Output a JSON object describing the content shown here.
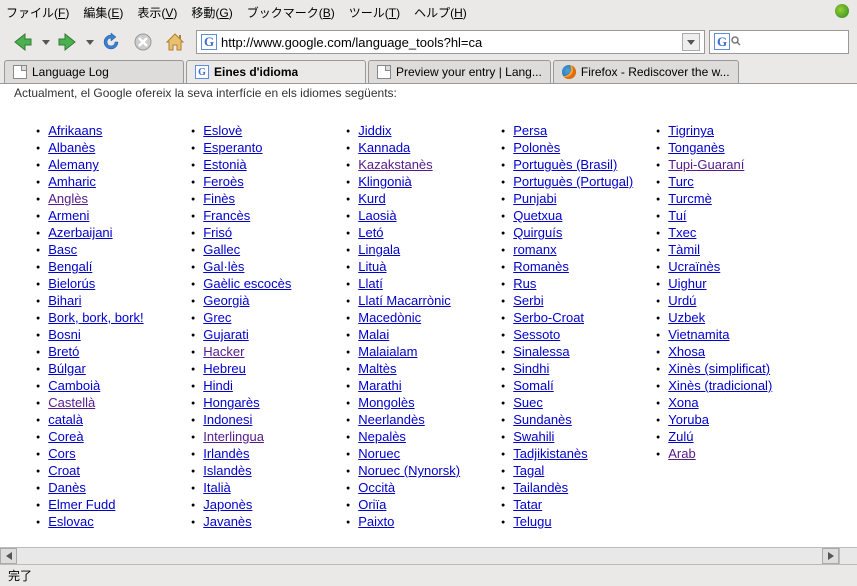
{
  "menubar": {
    "items": [
      "ファイル(F)",
      "編集(E)",
      "表示(V)",
      "移動(G)",
      "ブックマーク(B)",
      "ツール(T)",
      "ヘルプ(H)"
    ]
  },
  "toolbar": {
    "url": "http://www.google.com/language_tools?hl=ca",
    "search_placeholder": ""
  },
  "tabs": [
    {
      "label": "Language Log",
      "icon": "page",
      "active": false
    },
    {
      "label": "Eines d'idioma",
      "icon": "google",
      "active": true
    },
    {
      "label": "Preview your entry | Lang...",
      "icon": "page",
      "active": false
    },
    {
      "label": "Firefox - Rediscover the w...",
      "icon": "firefox",
      "active": false
    }
  ],
  "content": {
    "intro": "Actualment, el Google ofereix la seva interfície en els idiomes següents:",
    "columns": [
      [
        {
          "t": "Afrikaans"
        },
        {
          "t": "Albanès"
        },
        {
          "t": "Alemany"
        },
        {
          "t": "Amharic"
        },
        {
          "t": "Anglès",
          "v": true
        },
        {
          "t": "Armeni"
        },
        {
          "t": "Azerbaijani"
        },
        {
          "t": "Basc"
        },
        {
          "t": "Bengalí"
        },
        {
          "t": "Bielorús"
        },
        {
          "t": "Bihari"
        },
        {
          "t": "Bork, bork, bork!"
        },
        {
          "t": "Bosni"
        },
        {
          "t": "Bretó"
        },
        {
          "t": "Búlgar"
        },
        {
          "t": "Camboià"
        },
        {
          "t": "Castellà",
          "v": true
        },
        {
          "t": "català"
        },
        {
          "t": "Coreà"
        },
        {
          "t": "Cors"
        },
        {
          "t": "Croat"
        },
        {
          "t": "Danès"
        },
        {
          "t": "Elmer Fudd"
        },
        {
          "t": "Eslovac"
        }
      ],
      [
        {
          "t": "Eslovè"
        },
        {
          "t": "Esperanto"
        },
        {
          "t": "Estonià"
        },
        {
          "t": "Feroès"
        },
        {
          "t": "Finès"
        },
        {
          "t": "Francès"
        },
        {
          "t": "Frisó"
        },
        {
          "t": "Gallec"
        },
        {
          "t": "Gal·lès"
        },
        {
          "t": "Gaèlic escocès"
        },
        {
          "t": "Georgià"
        },
        {
          "t": "Grec"
        },
        {
          "t": "Gujarati"
        },
        {
          "t": "Hacker",
          "v": true
        },
        {
          "t": "Hebreu"
        },
        {
          "t": "Hindi"
        },
        {
          "t": "Hongarès"
        },
        {
          "t": "Indonesi"
        },
        {
          "t": "Interlingua",
          "v": true
        },
        {
          "t": "Irlandès"
        },
        {
          "t": "Islandès"
        },
        {
          "t": "Italià"
        },
        {
          "t": "Japonès"
        },
        {
          "t": "Javanès"
        }
      ],
      [
        {
          "t": "Jiddix"
        },
        {
          "t": "Kannada"
        },
        {
          "t": "Kazakstanès",
          "v": true
        },
        {
          "t": "Klingonià"
        },
        {
          "t": "Kurd"
        },
        {
          "t": "Laosià"
        },
        {
          "t": "Letó"
        },
        {
          "t": "Lingala"
        },
        {
          "t": "Lituà"
        },
        {
          "t": "Llatí"
        },
        {
          "t": "Llatí Macarrònic"
        },
        {
          "t": "Macedònic"
        },
        {
          "t": "Malai"
        },
        {
          "t": "Malaialam"
        },
        {
          "t": "Maltès"
        },
        {
          "t": "Marathi"
        },
        {
          "t": "Mongolès"
        },
        {
          "t": "Neerlandès"
        },
        {
          "t": "Nepalès"
        },
        {
          "t": "Noruec"
        },
        {
          "t": "Noruec (Nynorsk)"
        },
        {
          "t": "Occità"
        },
        {
          "t": "Oriïa"
        },
        {
          "t": "Paixto"
        }
      ],
      [
        {
          "t": "Persa"
        },
        {
          "t": "Polonès"
        },
        {
          "t": "Portuguès (Brasil)"
        },
        {
          "t": "Portuguès (Portugal)"
        },
        {
          "t": "Punjabi"
        },
        {
          "t": "Quetxua"
        },
        {
          "t": "Quirguís"
        },
        {
          "t": "romanx"
        },
        {
          "t": "Romanès"
        },
        {
          "t": "Rus"
        },
        {
          "t": "Serbi"
        },
        {
          "t": "Serbo-Croat"
        },
        {
          "t": "Sessoto"
        },
        {
          "t": "Sinalessa"
        },
        {
          "t": "Sindhi"
        },
        {
          "t": "Somalí"
        },
        {
          "t": "Suec"
        },
        {
          "t": "Sundanès"
        },
        {
          "t": "Swahili"
        },
        {
          "t": "Tadjikistanès"
        },
        {
          "t": "Tagal"
        },
        {
          "t": "Tailandès"
        },
        {
          "t": "Tatar"
        },
        {
          "t": "Telugu"
        }
      ],
      [
        {
          "t": "Tigrinya"
        },
        {
          "t": "Tonganès"
        },
        {
          "t": "Tupi-Guaraní",
          "v": true
        },
        {
          "t": "Turc"
        },
        {
          "t": "Turcmè"
        },
        {
          "t": "Tuí"
        },
        {
          "t": "Txec"
        },
        {
          "t": "Tàmil"
        },
        {
          "t": "Ucraïnès"
        },
        {
          "t": "Uighur"
        },
        {
          "t": "Urdú"
        },
        {
          "t": "Uzbek"
        },
        {
          "t": "Vietnamita"
        },
        {
          "t": "Xhosa"
        },
        {
          "t": "Xinès (simplificat)"
        },
        {
          "t": "Xinès (tradicional)"
        },
        {
          "t": "Xona"
        },
        {
          "t": "Yoruba"
        },
        {
          "t": "Zulú"
        },
        {
          "t": "Arab",
          "v": true
        }
      ]
    ]
  },
  "statusbar": {
    "text": "完了"
  }
}
